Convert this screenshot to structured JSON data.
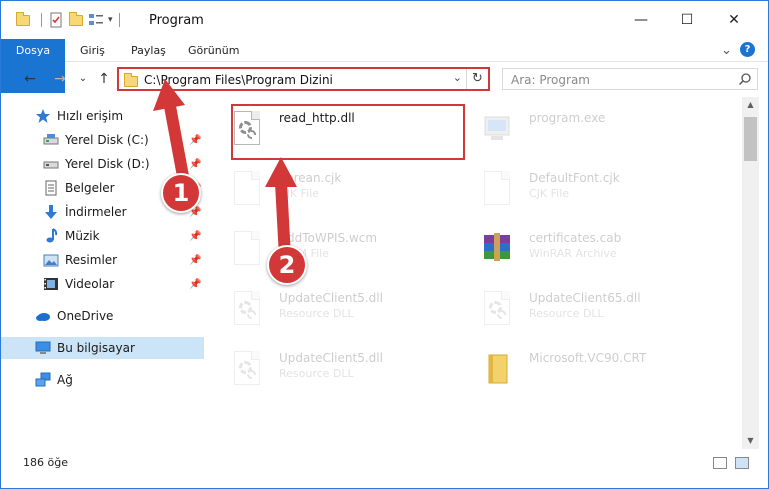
{
  "window": {
    "title": "Program",
    "controls": {
      "minimize": "—",
      "maximize": "☐",
      "close": "✕"
    }
  },
  "ribbon": {
    "tabs": [
      {
        "label": "Dosya",
        "active": true
      },
      {
        "label": "Giriş"
      },
      {
        "label": "Paylaş"
      },
      {
        "label": "Görünüm"
      }
    ],
    "expand_icon": "⌄",
    "help_icon": "?"
  },
  "address_bar": {
    "path": "C:\\Program Files\\Program Dizini",
    "dropdown_icon": "⌄",
    "refresh_icon": "↻"
  },
  "nav_buttons": {
    "back": "←",
    "forward": "→",
    "recent": "⌄",
    "up": "↑"
  },
  "search": {
    "placeholder": "Ara: Program"
  },
  "sidebar": {
    "items": [
      {
        "label": "Hızlı erişim",
        "icon": "star-icon"
      },
      {
        "label": "Yerel Disk (C:)",
        "icon": "drive-icon",
        "pinned": true
      },
      {
        "label": "Yerel Disk (D:)",
        "icon": "drive-icon",
        "pinned": true
      },
      {
        "label": "Belgeler",
        "icon": "documents-icon",
        "pinned": true
      },
      {
        "label": "İndirmeler",
        "icon": "download-icon",
        "pinned": true
      },
      {
        "label": "Müzik",
        "icon": "music-icon",
        "pinned": true
      },
      {
        "label": "Resimler",
        "icon": "pictures-icon",
        "pinned": true
      },
      {
        "label": "Videolar",
        "icon": "videos-icon",
        "pinned": true
      },
      {
        "label": "OneDrive",
        "icon": "cloud-icon"
      },
      {
        "label": "Bu bilgisayar",
        "icon": "computer-icon",
        "selected": true
      },
      {
        "label": "Ağ",
        "icon": "network-icon"
      }
    ],
    "pin_glyph": "📌"
  },
  "files": [
    {
      "name": "read_http.dll",
      "type": "",
      "icon": "dll-icon",
      "highlighted": true
    },
    {
      "name": "program.exe",
      "type": "",
      "icon": "exe-icon"
    },
    {
      "name": "Korean.cjk",
      "type": "CJK File",
      "icon": "file-icon"
    },
    {
      "name": "DefaultFont.cjk",
      "type": "CJK File",
      "icon": "file-icon"
    },
    {
      "name": "AddToWPIS.wcm",
      "type": "WCM File",
      "icon": "file-icon"
    },
    {
      "name": "certificates.cab",
      "type": "WinRAR Archive",
      "icon": "archive-icon"
    },
    {
      "name": "UpdateClient5.dll",
      "type": "Resource DLL",
      "icon": "dll-icon"
    },
    {
      "name": "UpdateClient65.dll",
      "type": "Resource DLL",
      "icon": "dll-icon"
    },
    {
      "name": "UpdateClient5.dll",
      "type": "Resource DLL",
      "icon": "dll-icon"
    },
    {
      "name": "Microsoft.VC90.CRT",
      "type": "",
      "icon": "folder-icon"
    }
  ],
  "status": {
    "item_count": "186 öğe"
  },
  "annotations": {
    "step1": "1",
    "step2": "2"
  },
  "colors": {
    "accent": "#1a74d2",
    "highlight": "#d23838",
    "selection": "#cce4f7"
  }
}
